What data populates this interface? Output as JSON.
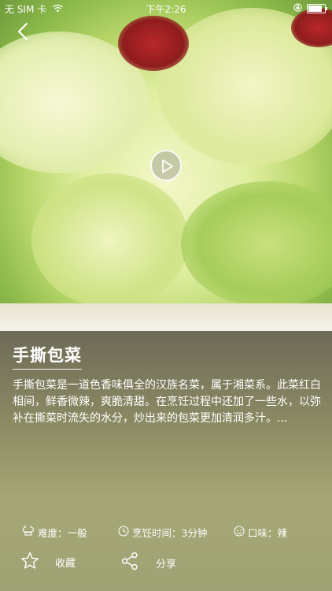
{
  "status_bar": {
    "carrier": "无 SIM 卡",
    "time": "下午2:26"
  },
  "hero": {
    "back_icon": "chevron-left-icon",
    "play_icon": "play-icon"
  },
  "dish": {
    "title": "手撕包菜",
    "description": "手撕包菜是一道色香味俱全的汉族名菜，属于湘菜系。此菜红白相间，鲜香微辣，爽脆清甜。在烹饪过程中还加了一些水，以弥补在撕菜时流失的水分，炒出来的包菜更加清润多汁。..."
  },
  "meta": {
    "difficulty": "难度：一般",
    "cook_time": "烹饪时间：3分钟",
    "taste": "口味：辣"
  },
  "actions": {
    "favorite": "收藏",
    "share": "分享"
  }
}
